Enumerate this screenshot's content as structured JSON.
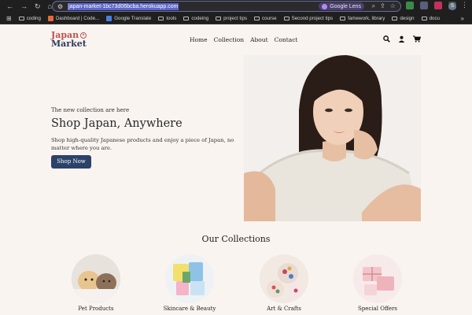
{
  "browser": {
    "url": "japan-market-1bc73d06bcba.herokuapp.com",
    "lens_label": "Google Lens",
    "profile_initial": "S",
    "bookmarks": [
      {
        "label": "coding",
        "type": "folder"
      },
      {
        "label": "Dashboard | Code...",
        "type": "site",
        "color": "#e6683c"
      },
      {
        "label": "Google Translate",
        "type": "site",
        "color": "#4a7fe0"
      },
      {
        "label": "tools",
        "type": "folder"
      },
      {
        "label": "codeing",
        "type": "folder"
      },
      {
        "label": "project tips",
        "type": "folder"
      },
      {
        "label": "course",
        "type": "folder"
      },
      {
        "label": "Second project tips",
        "type": "folder"
      },
      {
        "label": "famework, library",
        "type": "folder"
      },
      {
        "label": "design",
        "type": "folder"
      },
      {
        "label": "docu",
        "type": "folder"
      }
    ]
  },
  "site": {
    "logo_line1": "Japan",
    "logo_line2": "Market",
    "nav": [
      "Home",
      "Collection",
      "About",
      "Contact"
    ],
    "icons": [
      "search-icon",
      "user-icon",
      "cart-icon"
    ]
  },
  "hero": {
    "subtitle": "The new collection are here",
    "title": "Shop Japan, Anywhere",
    "description": "Shop high-quality Japanese products and enjoy a piece of Japan, no matter where you are.",
    "button": "Shop Now"
  },
  "collections": {
    "title": "Our Collections",
    "items": [
      {
        "label": "Pet Products"
      },
      {
        "label": "Skincare & Beauty"
      },
      {
        "label": "Art & Crafts"
      },
      {
        "label": "Special Offers"
      }
    ]
  },
  "colors": {
    "page_bg": "#faf4f0",
    "accent_red": "#c0504a",
    "navy": "#2c4268"
  }
}
